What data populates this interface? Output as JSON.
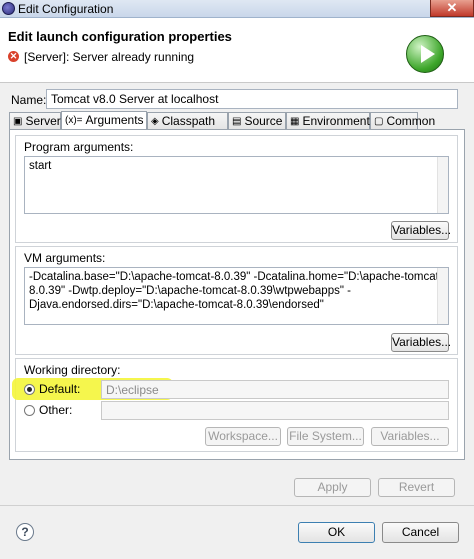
{
  "window": {
    "title": "Edit Configuration",
    "close_glyph": "✕"
  },
  "header": {
    "title": "Edit launch configuration properties",
    "message": "[Server]: Server already running",
    "error_glyph": "✕"
  },
  "name_field": {
    "label": "Name:",
    "value": "Tomcat v8.0 Server at localhost"
  },
  "tabs": [
    {
      "label": "Server",
      "icon": "▣"
    },
    {
      "label": "Arguments",
      "icon": "(x)="
    },
    {
      "label": "Classpath",
      "icon": "◈"
    },
    {
      "label": "Source",
      "icon": "▤"
    },
    {
      "label": "Environment",
      "icon": "▦"
    },
    {
      "label": "Common",
      "icon": "▢"
    }
  ],
  "program_args": {
    "label": "Program arguments:",
    "value": "start",
    "variables_label": "Variables..."
  },
  "vm_args": {
    "label": "VM arguments:",
    "lines": [
      "-Dcatalina.base=\"D:\\apache-tomcat-8.0.39\" -Dcatalina.home=\"D:\\apache-tomcat-",
      "8.0.39\" -Dwtp.deploy=\"D:\\apache-tomcat-8.0.39\\wtpwebapps\" -",
      "Djava.endorsed.dirs=\"D:\\apache-tomcat-8.0.39\\endorsed\""
    ],
    "variables_label": "Variables..."
  },
  "working_dir": {
    "label": "Working directory:",
    "default_label": "Default:",
    "default_value": "D:\\eclipse",
    "other_label": "Other:",
    "workspace_label": "Workspace...",
    "filesystem_label": "File System...",
    "variables_label": "Variables..."
  },
  "actions": {
    "apply_label": "Apply",
    "revert_label": "Revert",
    "ok_label": "OK",
    "cancel_label": "Cancel"
  },
  "help": {
    "glyph": "?"
  },
  "colors": {
    "highlight": "#f4f53a",
    "run_green": "#3da62a",
    "error_red": "#d9412b"
  }
}
